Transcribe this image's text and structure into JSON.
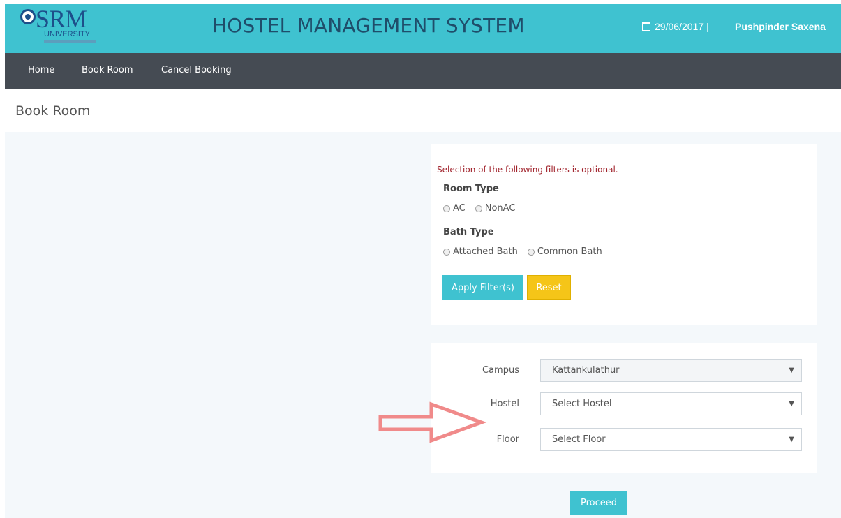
{
  "header": {
    "logo_text": "SRM",
    "logo_subtext": "UNIVERSITY",
    "title": "HOSTEL MANAGEMENT SYSTEM",
    "date": "29/06/2017",
    "separator": "|",
    "user_name": "Pushpinder Saxena",
    "icon": "calendar-icon",
    "background_color": "#3fc2d0"
  },
  "nav": {
    "items": [
      {
        "label": "Home"
      },
      {
        "label": "Book Room"
      },
      {
        "label": "Cancel Booking"
      }
    ],
    "background_color": "#454b53"
  },
  "page": {
    "title": "Book Room"
  },
  "filters": {
    "hint": "Selection of the following filters is optional.",
    "room_type": {
      "label": "Room Type",
      "options": [
        {
          "label": "AC",
          "checked": false
        },
        {
          "label": "NonAC",
          "checked": false
        }
      ]
    },
    "bath_type": {
      "label": "Bath Type",
      "options": [
        {
          "label": "Attached Bath",
          "checked": false
        },
        {
          "label": "Common Bath",
          "checked": false
        }
      ]
    },
    "apply_label": "Apply Filter(s)",
    "reset_label": "Reset"
  },
  "selection": {
    "campus": {
      "label": "Campus",
      "value": "Kattankulathur"
    },
    "hostel": {
      "label": "Hostel",
      "value": "Select Hostel"
    },
    "floor": {
      "label": "Floor",
      "value": "Select Floor"
    }
  },
  "proceed_label": "Proceed",
  "colors": {
    "accent": "#3fc2d0",
    "reset": "#f5c518",
    "hint": "#a0212a",
    "arrow": "#f08a8a"
  }
}
